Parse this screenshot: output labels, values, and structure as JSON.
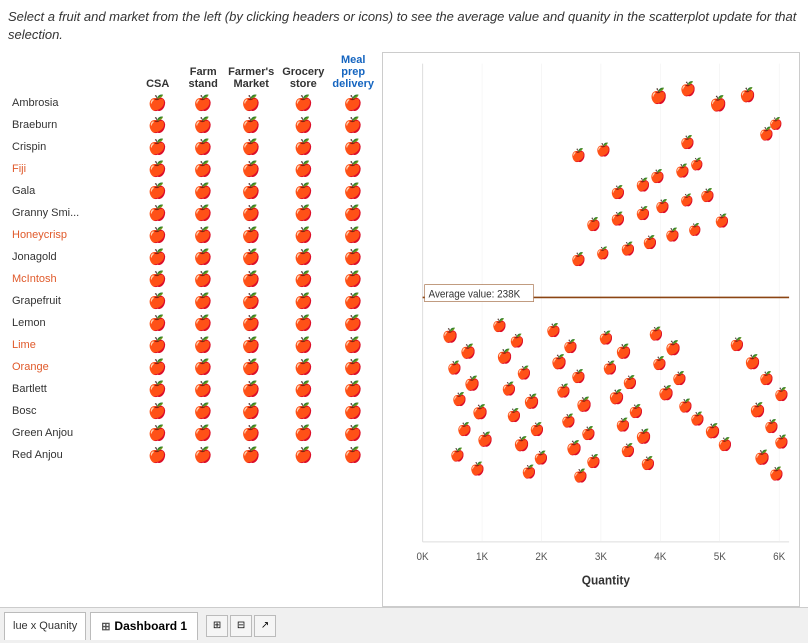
{
  "instruction": {
    "text": "Select a fruit and market from the left (by clicking  headers or icons) to see the average value and quanity in the scatterplot update for that selection."
  },
  "table": {
    "columns": [
      "",
      "CSA",
      "Farm stand",
      "Farmer's Market",
      "Grocery store",
      "Meal prep delivery"
    ],
    "rows": [
      {
        "name": "Ambrosia",
        "highlighted": false
      },
      {
        "name": "Braeburn",
        "highlighted": false
      },
      {
        "name": "Crispin",
        "highlighted": false
      },
      {
        "name": "Fiji",
        "highlighted": true
      },
      {
        "name": "Gala",
        "highlighted": false
      },
      {
        "name": "Granny Smi...",
        "highlighted": false
      },
      {
        "name": "Honeycrisp",
        "highlighted": true
      },
      {
        "name": "Jonagold",
        "highlighted": false
      },
      {
        "name": "McIntosh",
        "highlighted": true
      },
      {
        "name": "Grapefruit",
        "highlighted": false
      },
      {
        "name": "Lemon",
        "highlighted": false
      },
      {
        "name": "Lime",
        "highlighted": true
      },
      {
        "name": "Orange",
        "highlighted": true
      },
      {
        "name": "Bartlett",
        "highlighted": false
      },
      {
        "name": "Bosc",
        "highlighted": false
      },
      {
        "name": "Green Anjou",
        "highlighted": false
      },
      {
        "name": "Red Anjou",
        "highlighted": false
      }
    ]
  },
  "scatterplot": {
    "avg_label": "Average value: 238K",
    "x_axis_label": "Quantity",
    "x_ticks": [
      "0K",
      "1K",
      "2K",
      "3K",
      "4K",
      "5K",
      "6K"
    ],
    "avg_line_pct": 48
  },
  "tabs": [
    {
      "label": "lue x Quanity",
      "active": false,
      "partial": true
    },
    {
      "label": "Dashboard 1",
      "active": true,
      "partial": false
    }
  ],
  "icons": {
    "csa_colors": [
      "#2aafcf",
      "#2e7d32",
      "#e65c00",
      "#e6b800",
      "#1a237e"
    ],
    "fruit_emoji": "🍎"
  }
}
